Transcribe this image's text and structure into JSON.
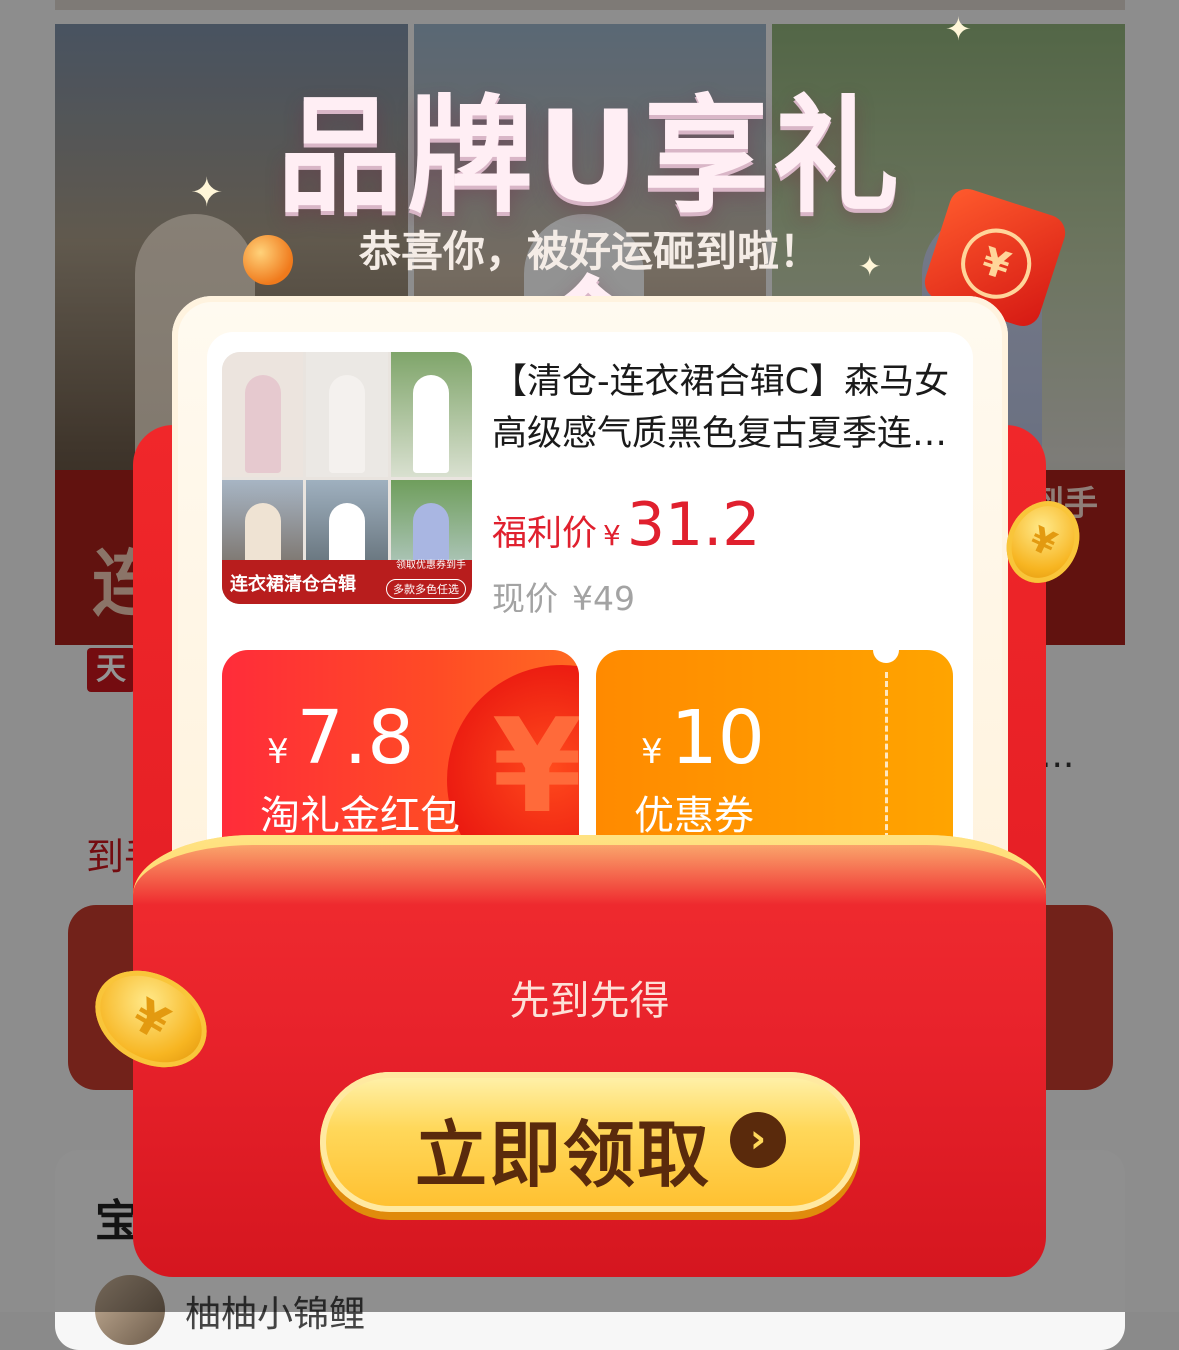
{
  "background": {
    "banner_text": "连",
    "banner_right_text": "到手",
    "tag": "天",
    "title_fragment": "【",
    "title_ellipsis": "...",
    "price_fragment": "到手",
    "section_title_fragment": "宝",
    "username": "柚柚小锦鲤"
  },
  "popup": {
    "title": "品牌U享礼金",
    "subtitle": "恭喜你，被好运砸到啦！",
    "product": {
      "title": "【清仓-连衣裙合辑C】森马女高级感气质黑色复古夏季连衣裙",
      "thumb_caption": "连衣裙清仓合辑",
      "thumb_note": "领取优惠券到手",
      "thumb_pill": "多款多色任选",
      "welfare_label": "福利价",
      "welfare_currency": "¥",
      "welfare_price": "31.2",
      "current_label": "现价",
      "current_price": "¥49"
    },
    "coupons": [
      {
        "currency": "¥",
        "amount": "7.8",
        "label": "淘礼金红包",
        "watermark": "¥"
      },
      {
        "currency": "¥",
        "amount": "10",
        "label": "优惠券"
      }
    ],
    "first_come": "先到先得",
    "claim_button": "立即领取",
    "claim_arrow": "›",
    "coin_symbol": "¥"
  },
  "colors": {
    "accent_red": "#e0202e",
    "envelope_red": "#e8222b",
    "coupon_orange": "#ff9500",
    "button_gold": "#ffd85b",
    "button_text": "#5a2a0c"
  }
}
